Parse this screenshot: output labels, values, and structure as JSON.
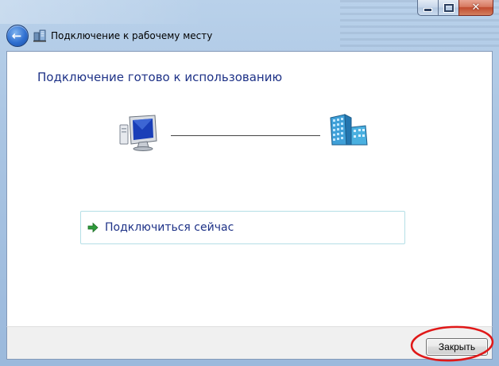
{
  "window": {
    "title": "Подключение к рабочему месту"
  },
  "caption_buttons": {
    "minimize": "minimize",
    "maximize": "maximize",
    "close": "close"
  },
  "main": {
    "heading": "Подключение готово к использованию",
    "connect_link_label": "Подключиться сейчас"
  },
  "footer": {
    "close_button_label": "Закрыть"
  },
  "icons": {
    "back": "back-arrow-icon",
    "title": "workplace-connection-icon",
    "computer": "computer-icon",
    "server": "server-building-icon",
    "link_arrow": "green-arrow-icon"
  },
  "colors": {
    "heading": "#1e3287",
    "link_border": "#b5dfe6",
    "arrow": "#2e9a3a",
    "annotation": "#e01818"
  }
}
